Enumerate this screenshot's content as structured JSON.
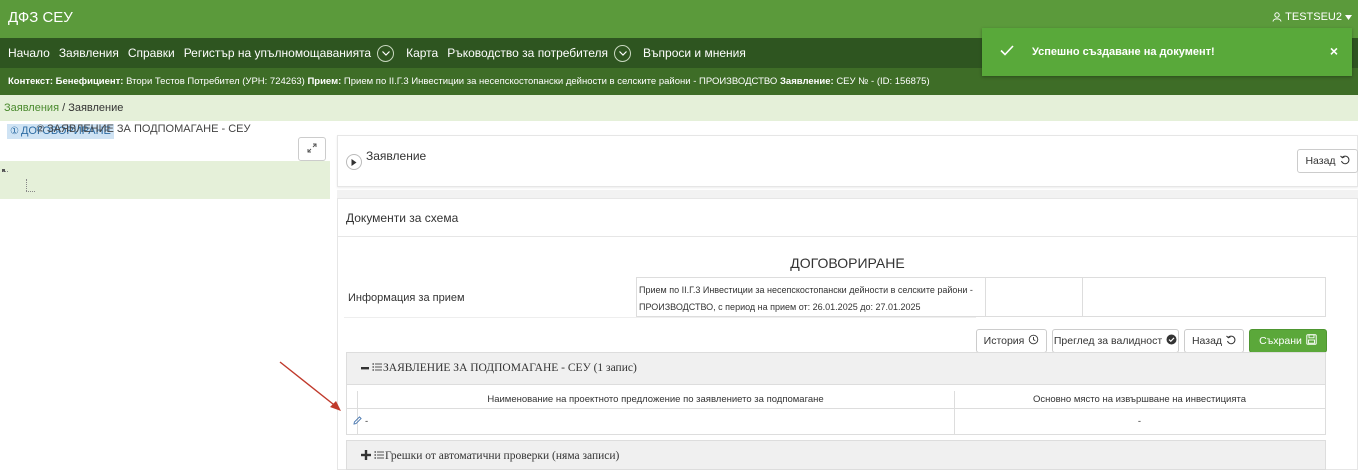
{
  "app": {
    "title": "ДФЗ СЕУ",
    "user": "TESTSEU2"
  },
  "nav": {
    "items": [
      "Начало",
      "Заявления",
      "Справки",
      "Регистър на упълномощаванията",
      "Карта",
      "Ръководство за потребителя",
      "Въпроси и мнения"
    ]
  },
  "context": {
    "label_context": "Контекст:",
    "label_beneficiary": "Бенефициент:",
    "beneficiary": "Втори Тестов Потребител (УРН: 724263)",
    "label_intake": "Прием:",
    "intake": "Прием по II.Г.3 Инвестиции за несепскостопански дейности в селските райони - ПРОИЗВОДСТВО",
    "label_application": "Заявление:",
    "application": "СЕУ № - (ID: 156875)"
  },
  "breadcrumb": {
    "link": "Заявления",
    "separator": " / ",
    "current": "Заявление"
  },
  "toast": {
    "message": "Успешно създаване на документ!",
    "close": "×"
  },
  "tree": {
    "node1": {
      "num": "①",
      "label": "ДОГОВОРИРАНЕ"
    },
    "node2": {
      "num": "②",
      "label": "ЗАЯВЛЕНИЕ ЗА ПОДПОМАГАНЕ - СЕУ"
    }
  },
  "header": {
    "title": "Заявление",
    "back_label": "Назад"
  },
  "docs": {
    "title": "Документи за схема",
    "section_title": "ДОГОВОРИРАНЕ",
    "info_label": "Информация за прием",
    "info_value": "Прием по II.Г.3 Инвестиции за несепскостопански дейности в селските райони - ПРОИЗВОДСТВО, с период на прием от: 26.01.2025 до: 27.01.2025",
    "buttons": {
      "history": "История",
      "validity": "Преглед за валидност",
      "back": "Назад",
      "save": "Съхрани"
    }
  },
  "accordion1": {
    "title": "ЗАЯВЛЕНИЕ ЗА ПОДПОМАГАНЕ - СЕУ (1 запис)",
    "col1": "Наименование на проектното предложение по заявлението за подпомагане",
    "col2": "Основно място на извършване на инвестицията",
    "row": {
      "c1": "-",
      "c2": "-"
    }
  },
  "accordion2": {
    "title": "Грешки от автоматични проверки (няма записи)"
  },
  "colors": {
    "topbar": "#5b9a3b",
    "navbar": "#2e5520",
    "context": "#3e6d27",
    "save_button": "#5ba83a",
    "annotation_arrow": "#c0392b"
  }
}
